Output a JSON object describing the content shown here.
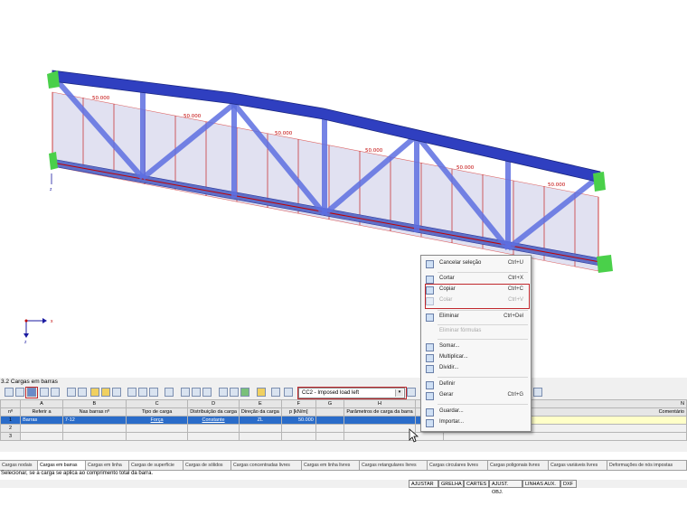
{
  "viewport": {
    "load_labels": [
      "50.000",
      "50.000",
      "50.000",
      "50.000",
      "50.000",
      "50.000"
    ],
    "axis_labels": {
      "x": "x",
      "z": "z"
    }
  },
  "context_menu": {
    "items": [
      {
        "label": "Cancelar seleção",
        "shortcut": "Ctrl+U",
        "icon": "deselect-icon",
        "disabled": false
      },
      {
        "label": "Cortar",
        "shortcut": "Ctrl+X",
        "icon": "scissors-icon",
        "disabled": false
      },
      {
        "label": "Copiar",
        "shortcut": "Ctrl+C",
        "icon": "copy-icon",
        "disabled": false
      },
      {
        "label": "Colar",
        "shortcut": "Ctrl+V",
        "icon": "paste-icon",
        "disabled": true
      },
      {
        "label": "Eliminar",
        "shortcut": "Ctrl+Del",
        "icon": "delete-icon",
        "disabled": false
      },
      {
        "label": "Eliminar fórmulas",
        "shortcut": "",
        "icon": "",
        "disabled": true
      },
      {
        "label": "Somar...",
        "shortcut": "",
        "icon": "sum-icon",
        "disabled": false
      },
      {
        "label": "Multiplicar...",
        "shortcut": "",
        "icon": "multiply-icon",
        "disabled": false
      },
      {
        "label": "Dividir...",
        "shortcut": "",
        "icon": "divide-icon",
        "disabled": false
      },
      {
        "label": "Definir",
        "shortcut": "",
        "icon": "define-icon",
        "disabled": false
      },
      {
        "label": "Gerar",
        "shortcut": "Ctrl+G",
        "icon": "generate-icon",
        "disabled": false
      },
      {
        "label": "Guardar...",
        "shortcut": "",
        "icon": "save-icon",
        "disabled": false
      },
      {
        "label": "Importar...",
        "shortcut": "",
        "icon": "import-icon",
        "disabled": false
      }
    ]
  },
  "panel": {
    "title": "3.2 Cargas em barras",
    "load_case": "CC2 - Imposed load left"
  },
  "grid": {
    "col_letters": [
      "",
      "A",
      "B",
      "C",
      "D",
      "E",
      "F",
      "G",
      "H",
      "I",
      "N"
    ],
    "headers": [
      "nº",
      "Referir a",
      "Nas barras nº",
      "Tipo de carga",
      "Distribuição da carga",
      "Direção da carga",
      "p [kN/m]",
      "",
      "Parâmetros de carga da barra",
      "",
      "Comentário"
    ],
    "rows": [
      [
        "1",
        "Barras",
        "7-12",
        "Força",
        "Constante",
        "ZL",
        "50.000",
        "",
        "",
        "",
        ""
      ],
      [
        "2",
        "",
        "",
        "",
        "",
        "",
        "",
        "",
        "",
        "",
        ""
      ],
      [
        "3",
        "",
        "",
        "",
        "",
        "",
        "",
        "",
        "",
        "",
        ""
      ]
    ]
  },
  "tabs": [
    "Cargas nodais",
    "Cargas em barras",
    "Cargas em linha",
    "Cargas de superfície",
    "Cargas de sólidos",
    "Cargas concentradas livres",
    "Cargas em linha livres",
    "Cargas retangulares livres",
    "Cargas circulares livres",
    "Cargas poligonais livres",
    "Cargas variáveis livres",
    "Deformações de nós impostas"
  ],
  "status_text": "Selecionar, se a carga se aplica ao comprimento total da barra.",
  "statusbar": [
    "AJUSTAR",
    "GRELHA",
    "CARTES",
    "AJUST. OBJ.",
    "LINHAS AUX.",
    "DXF"
  ],
  "colors": {
    "accent": "#c0282d",
    "member": "#3f54d6",
    "load": "#c00000",
    "selection": "#2a6cc9"
  }
}
